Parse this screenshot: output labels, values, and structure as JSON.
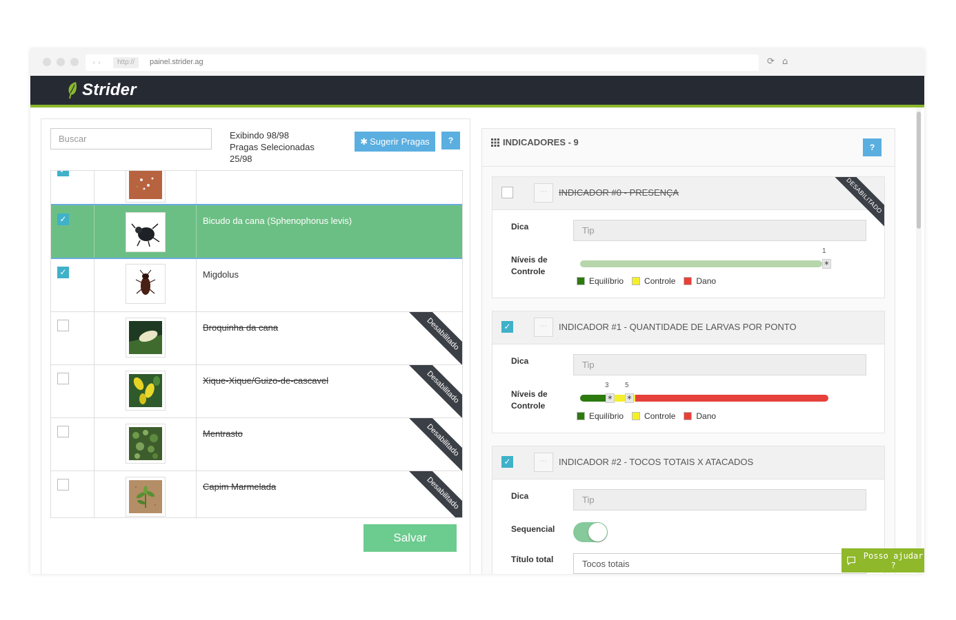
{
  "browser": {
    "protocol": "http://",
    "url": "painel.strider.ag"
  },
  "app": {
    "brand": "Strider",
    "brand_color": "#8ab82d",
    "header_color": "#262a33"
  },
  "left": {
    "search_placeholder": "Buscar",
    "counts": {
      "showing": "Exibindo 98/98",
      "selected_label": "Pragas Selecionadas",
      "selected_value": "25/98"
    },
    "suggest_button": "Sugerir Pragas",
    "help_button": "?",
    "save_button": "Salvar",
    "pests": [
      {
        "name": "",
        "checked": true,
        "disabled": false,
        "selected": false,
        "image": "small-insects-on-soil"
      },
      {
        "name": "Bicudo da cana (Sphenophorus levis)",
        "checked": true,
        "disabled": false,
        "selected": true,
        "image": "black-weevil"
      },
      {
        "name": "Migdolus",
        "checked": true,
        "disabled": false,
        "selected": false,
        "image": "brown-beetle"
      },
      {
        "name": "Broquinha da cana",
        "checked": false,
        "disabled": true,
        "badge": "Desabilitado",
        "selected": false,
        "image": "moth-on-leaf"
      },
      {
        "name": "Xique-Xique/Guizo-de-cascavel",
        "checked": false,
        "disabled": true,
        "badge": "Desabilitado",
        "selected": false,
        "image": "yellow-flowers"
      },
      {
        "name": "Mentrasto",
        "checked": false,
        "disabled": true,
        "badge": "Desabilitado",
        "selected": false,
        "image": "green-weed"
      },
      {
        "name": "Capim Marmelada",
        "checked": false,
        "disabled": true,
        "badge": "Desabilitado",
        "selected": false,
        "image": "grass-seedling"
      }
    ]
  },
  "right": {
    "title": "INDICADORES - 9",
    "help_button": "?",
    "cards": [
      {
        "title": "INDICADOR #0 - PRESENÇA",
        "checked": false,
        "disabled": true,
        "badge": "DESABILITADO",
        "dica_label": "Dica",
        "tip_placeholder": "Tip",
        "levels_label_1": "Níveis de",
        "levels_label_2": "Controle",
        "thresholds": [
          1
        ],
        "legend": [
          "Equilíbrio",
          "Controle",
          "Dano"
        ]
      },
      {
        "title": "INDICADOR #1 - QUANTIDADE DE LARVAS POR PONTO",
        "checked": true,
        "disabled": false,
        "dica_label": "Dica",
        "tip_placeholder": "Tip",
        "levels_label_1": "Níveis de",
        "levels_label_2": "Controle",
        "thresholds": [
          3,
          5
        ],
        "legend": [
          "Equilíbrio",
          "Controle",
          "Dano"
        ]
      },
      {
        "title": "INDICADOR #2 - TOCOS TOTAIS X ATACADOS",
        "checked": true,
        "disabled": false,
        "dica_label": "Dica",
        "tip_placeholder": "Tip",
        "sequential_label": "Sequencial",
        "sequential_on": true,
        "total_title_label": "Título total",
        "total_title_value": "Tocos totais"
      }
    ],
    "colors": {
      "equilibrio": "#2d7a0f",
      "controle": "#f3ef2b",
      "dano": "#e5413a"
    }
  },
  "help_widget": "Posso ajudar ?"
}
